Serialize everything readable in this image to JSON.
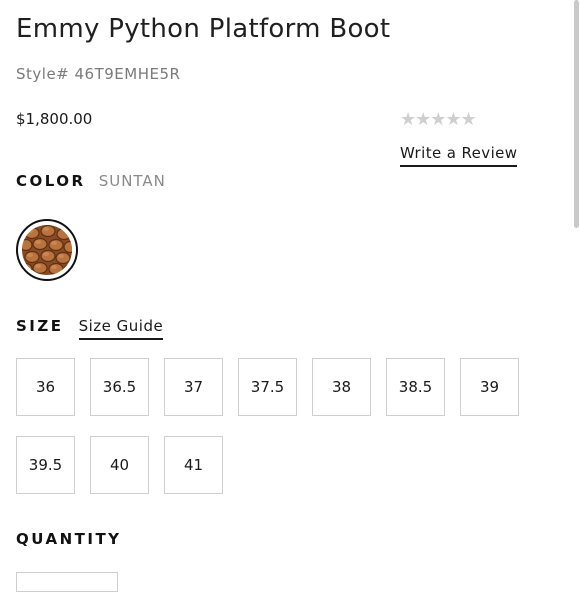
{
  "product": {
    "title": "Emmy Python Platform Boot",
    "style_line": "Style# 46T9EMHE5R",
    "price": "$1,800.00",
    "rating_stars": "★★★★★",
    "write_review_label": "Write a Review"
  },
  "color": {
    "label": "COLOR",
    "value": "SUNTAN",
    "swatch_colors": {
      "base": "#8a4a23",
      "scale": "#b8733e",
      "highlight": "#d79a63"
    }
  },
  "size": {
    "label": "SIZE",
    "guide_label": "Size Guide",
    "options": [
      "36",
      "36.5",
      "37",
      "37.5",
      "38",
      "38.5",
      "39",
      "39.5",
      "40",
      "41"
    ]
  },
  "quantity": {
    "label": "QUANTITY"
  }
}
